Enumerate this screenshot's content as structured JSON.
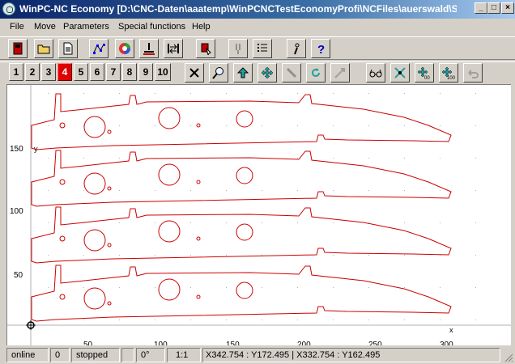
{
  "window": {
    "title": "WinPC-NC Economy [D:\\CNC-Daten\\aaatemp\\WinPCNCTestEconomyProfi\\NCFiles\\auerswald\\Sper...",
    "minimize_glyph": "_",
    "maximize_glyph": "□",
    "close_glyph": "×"
  },
  "menu": [
    "File",
    "Move",
    "Parameters",
    "Special functions",
    "Help"
  ],
  "toolbar_main": [
    {
      "name": "exit-icon"
    },
    {
      "name": "open-folder-icon"
    },
    {
      "name": "document-icon"
    },
    {
      "name": "path-nodes-icon"
    },
    {
      "name": "color-wheel-icon"
    },
    {
      "name": "tool-zero-icon"
    },
    {
      "name": "reference-run-icon"
    },
    {
      "name": "settings-cursor-icon"
    },
    {
      "name": "tool-change-icon"
    },
    {
      "name": "list-icon"
    },
    {
      "name": "info-icon"
    },
    {
      "name": "help-icon"
    }
  ],
  "views": {
    "labels": [
      "1",
      "2",
      "3",
      "4",
      "5",
      "6",
      "7",
      "8",
      "9",
      "10"
    ],
    "active": "4"
  },
  "toolbar_view": [
    {
      "name": "cancel-icon"
    },
    {
      "name": "zoom-icon"
    },
    {
      "name": "arrow-up-icon"
    },
    {
      "name": "move-arrows-icon"
    },
    {
      "name": "tool-icon"
    },
    {
      "name": "rotate-icon"
    },
    {
      "name": "axis-icon"
    },
    {
      "name": "glasses-icon"
    },
    {
      "name": "crosshair-icon"
    },
    {
      "name": "move-00-icon"
    },
    {
      "name": "move-100-icon"
    },
    {
      "name": "undo-icon"
    }
  ],
  "plot": {
    "y_ticks": [
      "150",
      "100",
      "50"
    ],
    "x_ticks": [
      "50",
      "100",
      "150",
      "200",
      "250",
      "300"
    ],
    "x_axis_label": "x",
    "y_axis_label": "y",
    "line_color": "#cc0000"
  },
  "status": {
    "connection": "online",
    "count": "0",
    "state": "stopped",
    "angle": "0°",
    "scale": "1:1",
    "coords": "X342.754 : Y172.495  |  X332.754 : Y162.495"
  }
}
